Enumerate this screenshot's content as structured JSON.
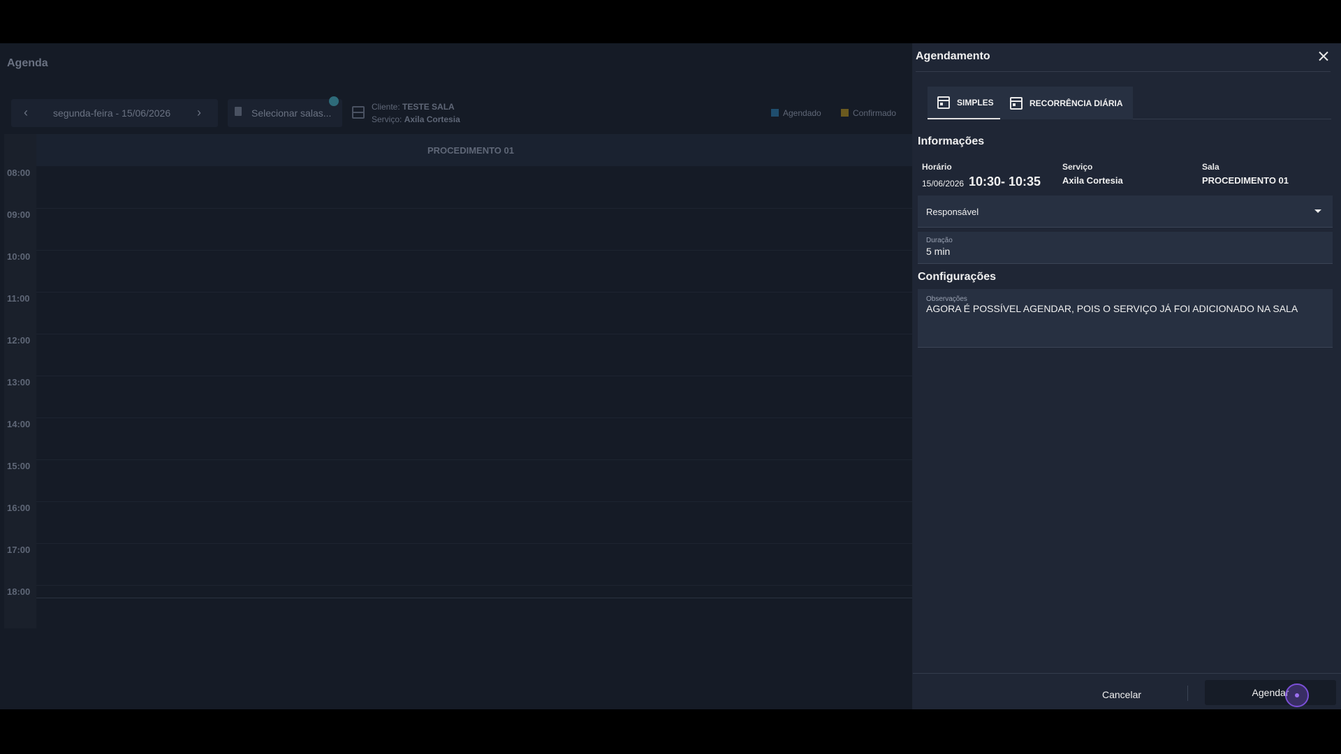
{
  "agenda": {
    "title": "Agenda",
    "date_label": "segunda-feira - 15/06/2026",
    "room_select_placeholder": "Selecionar salas...",
    "client_label": "Cliente:",
    "client_value": "TESTE SALA",
    "service_label": "Serviço:",
    "service_value": "Axila Cortesia",
    "legend": [
      {
        "label": "Agendado",
        "color": "#1f4e6e"
      },
      {
        "label": "Confirmado",
        "color": "#6b5a1f"
      }
    ],
    "column_header": "PROCEDIMENTO 01",
    "times": [
      "08:00",
      "09:00",
      "10:00",
      "11:00",
      "12:00",
      "13:00",
      "14:00",
      "15:00",
      "16:00",
      "17:00",
      "18:00"
    ]
  },
  "drawer": {
    "title": "Agendamento",
    "tabs": [
      {
        "label": "SIMPLES",
        "icon": "calendar-icon"
      },
      {
        "label": "RECORRÊNCIA DIÁRIA",
        "icon": "calendar-icon"
      }
    ],
    "info_section": "Informações",
    "horario_label": "Horário",
    "horario_date": "15/06/2026",
    "horario_time": "10:30- 10:35",
    "servico_label": "Serviço",
    "servico_value": "Axila Cortesia",
    "sala_label": "Sala",
    "sala_value": "PROCEDIMENTO 01",
    "responsavel_label": "Responsável",
    "duracao_label": "Duração",
    "duracao_value": "5 min",
    "config_section": "Configurações",
    "observacoes_label": "Observações",
    "observacoes_value": "AGORA É POSSÍVEL AGENDAR, POIS O SERVIÇO JÁ FOI ADICIONADO NA SALA",
    "cancel_label": "Cancelar",
    "submit_label": "Agendar"
  }
}
